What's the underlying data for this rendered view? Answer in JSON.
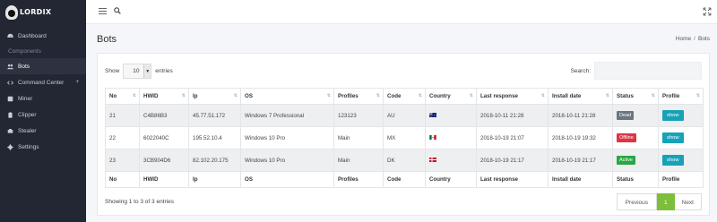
{
  "brand": {
    "name": "LORDIX"
  },
  "sidebar": {
    "section_label": "Components",
    "items": [
      {
        "label": "Dashboard",
        "icon": "dashboard-icon"
      },
      {
        "label": "Bots",
        "icon": "users-icon"
      },
      {
        "label": "Command Center",
        "icon": "code-icon",
        "caret": "+"
      },
      {
        "label": "Miner",
        "icon": "miner-icon"
      },
      {
        "label": "Clipper",
        "icon": "clipboard-icon"
      },
      {
        "label": "Stealer",
        "icon": "steal-icon"
      },
      {
        "label": "Settings",
        "icon": "gear-icon"
      }
    ]
  },
  "page": {
    "title": "Bots",
    "breadcrumb": {
      "home": "Home",
      "current": "Bots",
      "separator": "/"
    }
  },
  "table_controls": {
    "show_label": "Show",
    "entries_value": "10",
    "entries_label": "entries",
    "search_label": "Search:"
  },
  "table": {
    "columns": [
      "No",
      "HWID",
      "Ip",
      "OS",
      "Profiles",
      "Code",
      "Country",
      "Last response",
      "Install date",
      "Status",
      "Profile"
    ],
    "rows": [
      {
        "no": "21",
        "hwid": "C4B86B3",
        "ip": "45.77.51.172",
        "os": "Windows 7 Professional",
        "profiles": "123123",
        "code": "AU",
        "country_flag": "flag-au",
        "last": "2018-10-11 21:28",
        "install": "2018-10-11 21:28",
        "status": "Dead",
        "status_color": "#6c757d",
        "action": "show"
      },
      {
        "no": "22",
        "hwid": "6022040C",
        "ip": "195.52.10.4",
        "os": "Windows 10 Pro",
        "profiles": "Main",
        "code": "MX",
        "country_flag": "flag-mx",
        "last": "2018-10-19 21:07",
        "install": "2018-10-19 19:32",
        "status": "Offline",
        "status_color": "#dc3545",
        "action": "show"
      },
      {
        "no": "23",
        "hwid": "3CB904D6",
        "ip": "82.102.20.175",
        "os": "Windows 10 Pro",
        "profiles": "Main",
        "code": "DK",
        "country_flag": "flag-dk",
        "last": "2018-10-19 21:17",
        "install": "2018-10-19 21:17",
        "status": "Active",
        "status_color": "#28a745",
        "action": "show"
      }
    ]
  },
  "footer": {
    "info": "Showing 1 to 3 of 3 entries",
    "pagination": {
      "previous": "Previous",
      "current": "1",
      "next": "Next"
    }
  },
  "colors": {
    "sidebar_bg": "#222733",
    "accent_green": "#7cbf3a",
    "show_button": "#17a2b8"
  }
}
